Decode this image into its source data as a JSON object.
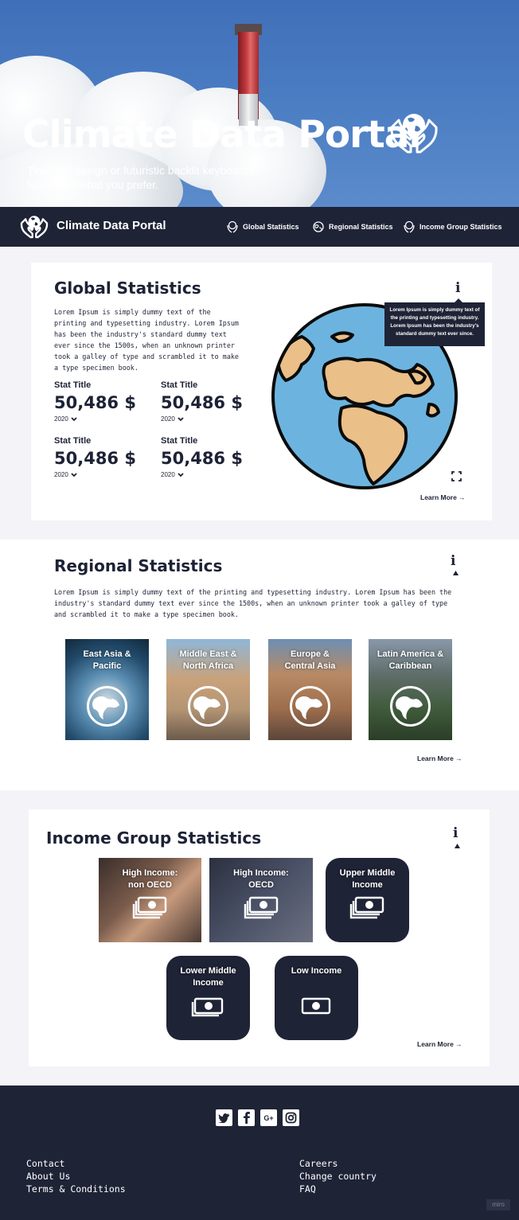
{
  "hero": {
    "title": "Climate Data Portal",
    "subtitle_line1": "Timeless design or futuristic backlit keyboard?",
    "subtitle_line2": "No matter what you prefer."
  },
  "nav": {
    "brand": "Climate Data Portal",
    "links": [
      {
        "label": "Global Statistics",
        "icon": "globe-hands-icon"
      },
      {
        "label": "Regional Statistics",
        "icon": "globe-icon"
      },
      {
        "label": "Income Group Statistics",
        "icon": "globe-hands-icon"
      }
    ]
  },
  "global": {
    "title": "Global Statistics",
    "description": "Lorem Ipsum is simply dummy text of the printing and typesetting industry. Lorem Ipsum has been the industry's standard dummy text ever since the 1500s, when an unknown printer took a galley of type and scrambled it to make a type specimen book.",
    "info_label": "i",
    "tooltip": "Lorem Ipsum is simply dummy text of the printing and typesetting industry. Lorem Ipsum has been the industry's standard dummy text ever since.",
    "stats": [
      {
        "title": "Stat Title",
        "value": "50,486 $",
        "year": "2020"
      },
      {
        "title": "Stat Title",
        "value": "50,486 $",
        "year": "2020"
      },
      {
        "title": "Stat Title",
        "value": "50,486 $",
        "year": "2020"
      },
      {
        "title": "Stat Title",
        "value": "50,486 $",
        "year": "2020"
      }
    ],
    "learn_more": "Learn More →"
  },
  "regional": {
    "title": "Regional Statistics",
    "info_label": "i",
    "description": "Lorem Ipsum is simply dummy text of the printing and typesetting industry. Lorem Ipsum has been the industry's standard dummy text ever since the 1500s, when an unknown printer took a galley of type and scrambled it to make a type specimen book.",
    "regions": [
      {
        "line1": "East Asia &",
        "line2": "Pacific"
      },
      {
        "line1": "Middle East &",
        "line2": "North Africa"
      },
      {
        "line1": "Europe &",
        "line2": "Central Asia"
      },
      {
        "line1": "Latin America &",
        "line2": "Caribbean"
      }
    ],
    "learn_more": "Learn More →"
  },
  "income": {
    "title": "Income Group Statistics",
    "info_label": "i",
    "groups": [
      {
        "line1": "High Income:",
        "line2": "non OECD"
      },
      {
        "line1": "High Income:",
        "line2": "OECD"
      },
      {
        "line1": "Upper Middle",
        "line2": "Income"
      },
      {
        "line1": "Lower Middle",
        "line2": "Income"
      },
      {
        "line1": "Low Income",
        "line2": ""
      }
    ],
    "learn_more": "Learn More →"
  },
  "footer": {
    "social": [
      "twitter-icon",
      "facebook-icon",
      "google-plus-icon",
      "instagram-icon"
    ],
    "links_left": [
      "Contact",
      "About Us",
      "Terms & Conditions"
    ],
    "links_right": [
      "Careers",
      "Change country",
      "FAQ"
    ],
    "badge": "miro"
  },
  "colors": {
    "navy": "#1f2336",
    "ocean": "#6cb4df",
    "land": "#eabf88",
    "background": "#f4f3f8"
  }
}
